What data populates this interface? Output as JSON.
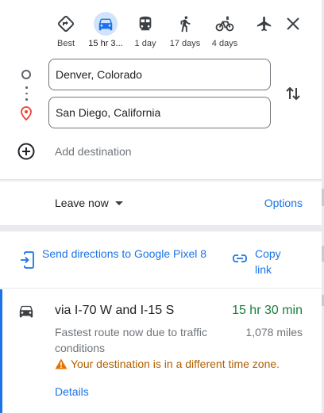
{
  "travel_modes": [
    {
      "id": "best",
      "label": "Best",
      "icon": "diamond-turn-icon",
      "active": false
    },
    {
      "id": "driving",
      "label": "15 hr 3...",
      "icon": "car-icon",
      "active": true
    },
    {
      "id": "transit",
      "label": "1 day",
      "icon": "train-icon",
      "active": false
    },
    {
      "id": "walking",
      "label": "17 days",
      "icon": "walk-icon",
      "active": false
    },
    {
      "id": "cycling",
      "label": "4 days",
      "icon": "bike-icon",
      "active": false
    },
    {
      "id": "flights",
      "label": "",
      "icon": "airplane-icon",
      "active": false
    }
  ],
  "route": {
    "origin": "Denver, Colorado",
    "destination": "San Diego, California",
    "add_destination": "Add destination"
  },
  "departure": {
    "label": "Leave now",
    "options_label": "Options"
  },
  "send": {
    "send_label": "Send directions to Google Pixel 8",
    "copy_label": "Copy link"
  },
  "route_option": {
    "via": "via I-70 W and I-15 S",
    "duration": "15 hr 30 min",
    "description": "Fastest route now due to traffic conditions",
    "distance": "1,078 miles",
    "warning": "Your destination is in a different time zone.",
    "details_label": "Details"
  },
  "colors": {
    "accent": "#1a73e8",
    "duration_green": "#188038",
    "warning": "#b06000",
    "destination_pin": "#ea4335",
    "active_mode_bg": "#d2e3fc"
  }
}
